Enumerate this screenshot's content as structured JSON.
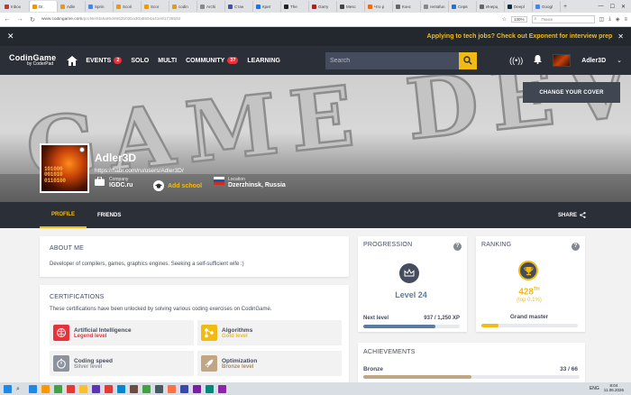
{
  "browser": {
    "tabs": [
      {
        "label": "Inbox",
        "color": "#d93025",
        "active": false
      },
      {
        "label": "Dr. ",
        "color": "#f29900",
        "active": true
      },
      {
        "label": "Adle",
        "color": "#f29900",
        "active": false
      },
      {
        "label": "Sprin",
        "color": "#4285f4",
        "active": false
      },
      {
        "label": "Scori",
        "color": "#f29900",
        "active": false
      },
      {
        "label": "Scor",
        "color": "#f29900",
        "active": false
      },
      {
        "label": "codin",
        "color": "#f29900",
        "active": false
      },
      {
        "label": "Archi",
        "color": "#888888",
        "active": false
      },
      {
        "label": "Стан",
        "color": "#3f51b5",
        "active": false
      },
      {
        "label": "Крит",
        "color": "#1a73e8",
        "active": false
      },
      {
        "label": "The ",
        "color": "#222222",
        "active": false
      },
      {
        "label": "Garry",
        "color": "#b71c1c",
        "active": false
      },
      {
        "label": "Mesc",
        "color": "#444444",
        "active": false
      },
      {
        "label": "Что р",
        "color": "#ff6600",
        "active": false
      },
      {
        "label": "Конс",
        "color": "#666666",
        "active": false
      },
      {
        "label": "rentafun",
        "color": "#888888",
        "active": false
      },
      {
        "label": "Серв",
        "color": "#1a73e8",
        "active": false
      },
      {
        "label": "Инерц",
        "color": "#666666",
        "active": false
      },
      {
        "label": "Deepl",
        "color": "#0f2b46",
        "active": false
      },
      {
        "label": "Googl",
        "color": "#4285f4",
        "active": false
      }
    ],
    "url_host": "www.codingame.com",
    "url_path": "/profile/5fa6af6d4962b02ba30a5594a41e81735592",
    "zoom": "130%",
    "search_placeholder": "Поиск"
  },
  "promo": {
    "text": "Applying to tech jobs? Check out Exponent for interview prep"
  },
  "navbar": {
    "brand": "CodinGame",
    "brand_by": "by CoderPad",
    "items": [
      {
        "label": "EVENTS",
        "badge": "2"
      },
      {
        "label": "SOLO",
        "badge": null
      },
      {
        "label": "MULTI",
        "badge": null
      },
      {
        "label": "COMMUNITY",
        "badge": "37"
      },
      {
        "label": "LEARNING",
        "badge": null
      }
    ],
    "search_placeholder": "Search",
    "username": "Adler3D"
  },
  "cover": {
    "button": "CHANGE YOUR COVER",
    "art_text": "GAME DEV"
  },
  "profile": {
    "name": "Adler3D",
    "link": "https://habr.com/ru/users/Adler3D/",
    "avatar_text": [
      "101000",
      "001010",
      "0110100"
    ],
    "company_label": "Company",
    "company": "IGDC.ru",
    "add_school": "Add school",
    "location_label": "Location",
    "location": "Dzerzhinsk, Russia"
  },
  "tabs": {
    "profile": "PROFILE",
    "friends": "FRIENDS",
    "share": "SHARE"
  },
  "about": {
    "title": "ABOUT ME",
    "text": "Developer of compilers, games, graphics engines. Seeking a self-sufficient wife :)"
  },
  "certifications": {
    "title": "CERTIFICATIONS",
    "desc": "These certifications have been unlocked by solving various coding exercises on CodinGame.",
    "items": [
      {
        "name": "Artificial Intelligence",
        "level": "Legend level",
        "level_color": "#e7323c",
        "icon_color": "#e7323c"
      },
      {
        "name": "Algorithms",
        "level": "Gold level",
        "level_color": "#f2bb13",
        "icon_color": "#f2bb13"
      },
      {
        "name": "Coding speed",
        "level": "Silver level",
        "level_color": "#8c939d",
        "icon_color": "#8c939d"
      },
      {
        "name": "Optimization",
        "level": "Bronze level",
        "level_color": "#a58a66",
        "icon_color": "#c2a582"
      }
    ]
  },
  "progression": {
    "title": "PROGRESSION",
    "level": "Level 24",
    "next_label": "Next level",
    "xp": "937 / 1,250 XP",
    "progress": 0.75
  },
  "ranking": {
    "title": "RANKING",
    "rank": "428",
    "rank_suffix": "TH",
    "pct": "(top 0.1%)",
    "rank_title": "Grand master",
    "progress": 0.18
  },
  "achievements": {
    "title": "ACHIEVEMENTS",
    "tier": "Bronze",
    "count": "33 / 66",
    "progress": 0.5
  },
  "taskbar": {
    "lang": "ENG",
    "time": "8:04",
    "date": "11.06.2026",
    "apps": [
      "#1e88e5",
      "#ff9800",
      "#43a047",
      "#e53935",
      "#fbc02d",
      "#5e35b1",
      "#e53935",
      "#0288d1",
      "#6d4c41",
      "#43a047",
      "#455a64",
      "#ff7043",
      "#3949ab",
      "#7b1fa2",
      "#00897b",
      "#8e24aa"
    ]
  },
  "colors": {
    "accent": "#f2bb13",
    "nav_bg": "#2b3038",
    "badge_red": "#e7323c",
    "level_blue": "#5a7ca1"
  }
}
